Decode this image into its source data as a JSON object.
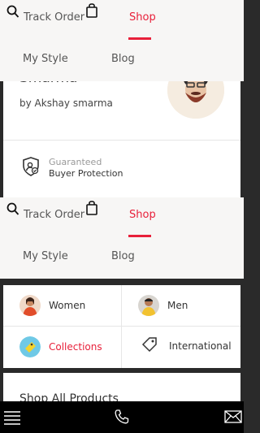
{
  "nav": {
    "track_order": "Track Order",
    "shop": "Shop",
    "my_style": "My Style",
    "blog": "Blog"
  },
  "designer": {
    "name": "Smarma",
    "by_line": "by Akshay smarma"
  },
  "guarantee": {
    "line1": "Guaranteed",
    "line2": "Buyer Protection"
  },
  "categories": [
    {
      "label": "Women"
    },
    {
      "label": "Men"
    },
    {
      "label": "Collections"
    },
    {
      "label": "International"
    }
  ],
  "shop_all": {
    "title": "Shop All Products"
  },
  "colors": {
    "accent": "#e8203a",
    "nav_bg": "#f7f6f5"
  },
  "icons": {
    "search": "search-icon",
    "bag": "bag-icon",
    "menu": "hamburger-menu-icon",
    "phone": "phone-icon",
    "mail": "mail-icon",
    "shield": "shield-user-icon",
    "tag": "tag-icon"
  }
}
